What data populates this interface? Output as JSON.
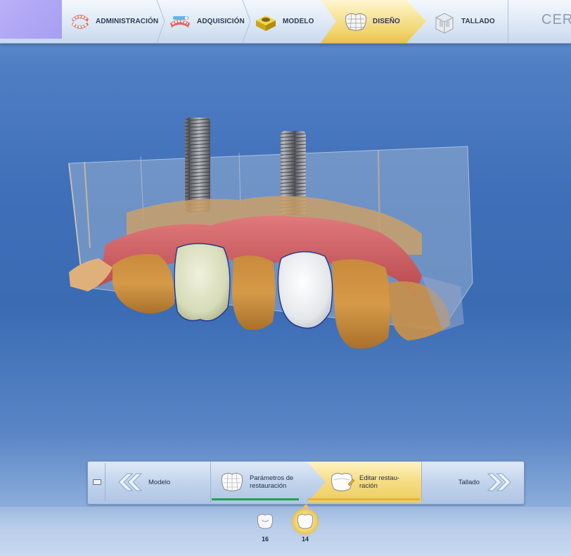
{
  "app": {
    "brand": "CERI"
  },
  "phases": [
    {
      "label": "ADMINISTRACIÓN",
      "icon": "dental-arch-icon",
      "active": false
    },
    {
      "label": "ADQUISICIÓN",
      "icon": "scan-jaw-icon",
      "active": false
    },
    {
      "label": "MODELO",
      "icon": "model-block-icon",
      "active": false
    },
    {
      "label": "DISEÑO",
      "icon": "crown-mesh-icon",
      "active": true
    },
    {
      "label": "TALLADO",
      "icon": "milling-unit-icon",
      "active": false
    }
  ],
  "workflow": {
    "prev": {
      "label": "Modelo",
      "icon": "double-chevron-left-icon"
    },
    "steps": [
      {
        "label_line1": "Parámetros de",
        "label_line2": "restauración",
        "icon": "crown-params-icon",
        "progress": 1.0,
        "active": false
      },
      {
        "label_line1": "Editar restau-",
        "label_line2": "ración",
        "icon": "crown-edit-icon",
        "progress": 1.0,
        "active": true
      }
    ],
    "next": {
      "label": "Tallado",
      "icon": "double-chevron-right-icon"
    }
  },
  "teeth": [
    {
      "number": "16",
      "active": false
    },
    {
      "number": "14",
      "active": true
    }
  ],
  "colors": {
    "active_phase": "#f1d46c",
    "progress_done": "#1fa24a",
    "viewport_bg": "#3f6fb8"
  }
}
